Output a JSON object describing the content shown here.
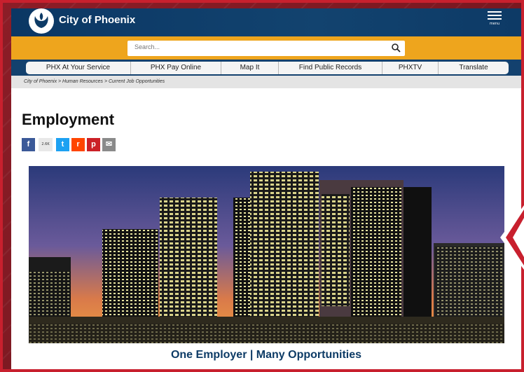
{
  "header": {
    "city_name": "City of Phoenix",
    "menu_label": "menu"
  },
  "search": {
    "placeholder": "Search..."
  },
  "nav": {
    "items": [
      {
        "label": "PHX At Your Service"
      },
      {
        "label": "PHX Pay Online"
      },
      {
        "label": "Map It"
      },
      {
        "label": "Find Public Records"
      },
      {
        "label": "PHXTV"
      },
      {
        "label": "Translate"
      }
    ]
  },
  "breadcrumb": "City of Phoenix > Human Resources > Current Job Opportunities",
  "page": {
    "title": "Employment",
    "share_count": "2.6K",
    "tagline": "One Employer | Many Opportunities"
  },
  "colors": {
    "header_blue": "#0d3b66",
    "search_gold": "#eea51d",
    "frame_red": "#c8202e"
  }
}
